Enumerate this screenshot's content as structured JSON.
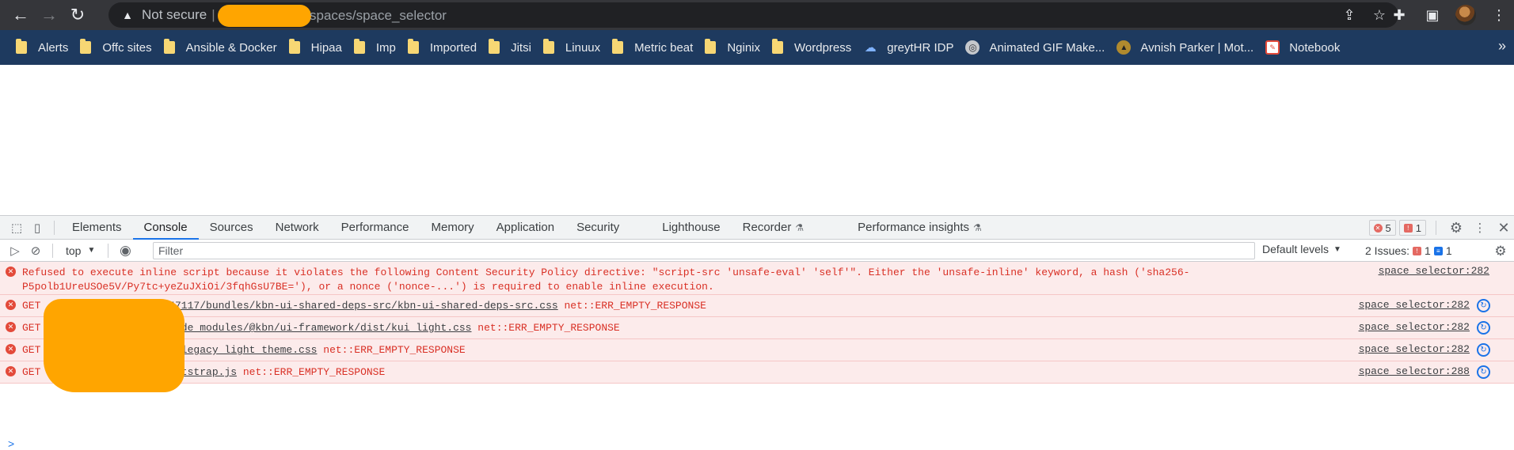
{
  "browser": {
    "not_secure": "Not secure",
    "url_path": "spaces/space_selector",
    "bookmarks": [
      {
        "label": "Alerts",
        "type": "folder"
      },
      {
        "label": "Offc sites",
        "type": "folder"
      },
      {
        "label": "Ansible & Docker",
        "type": "folder"
      },
      {
        "label": "Hipaa",
        "type": "folder"
      },
      {
        "label": "Imp",
        "type": "folder"
      },
      {
        "label": "Imported",
        "type": "folder"
      },
      {
        "label": "Jitsi",
        "type": "folder"
      },
      {
        "label": "Linuux",
        "type": "folder"
      },
      {
        "label": "Metric beat",
        "type": "folder"
      },
      {
        "label": "Nginix",
        "type": "folder"
      },
      {
        "label": "Wordpress",
        "type": "folder"
      },
      {
        "label": "greytHR IDP",
        "type": "site"
      },
      {
        "label": "Animated GIF Make...",
        "type": "site"
      },
      {
        "label": "Avnish Parker | Mot...",
        "type": "site"
      },
      {
        "label": "Notebook",
        "type": "site"
      }
    ]
  },
  "devtools": {
    "tabs": [
      "Elements",
      "Console",
      "Sources",
      "Network",
      "Performance",
      "Memory",
      "Application",
      "Security",
      "Lighthouse",
      "Recorder",
      "Performance insights"
    ],
    "active_tab": "Console",
    "error_count": "5",
    "issue_count_badge": "1",
    "context": "top",
    "filter_placeholder": "Filter",
    "levels": "Default levels",
    "issues_label": "2 Issues:",
    "issues_errors": "1",
    "issues_info": "1",
    "messages": [
      {
        "line1": "Refused to execute inline script because it violates the following Content Security Policy directive: \"script-src 'unsafe-eval' 'self'\". Either the 'unsafe-inline' keyword, a hash ('sha256-",
        "line2": "P5polb1UreUSOe5V/Py7tc+yeZuJXiOi/3fqhGsU7BE='), or a nonce ('nonce-...') is required to enable inline execution.",
        "source": "space_selector:282"
      },
      {
        "method": "GET",
        "url": "/47117/bundles/kbn-ui-shared-deps-src/kbn-ui-shared-deps-src.css",
        "status": "net::ERR_EMPTY_RESPONSE",
        "source": "space_selector:282"
      },
      {
        "method": "GET",
        "url": "/node_modules/@kbn/ui-framework/dist/kui_light.css",
        "status": "net::ERR_EMPTY_RESPONSE",
        "source": "space_selector:282"
      },
      {
        "method": "GET",
        "url": "ui/legacy_light_theme.css",
        "status": "net::ERR_EMPTY_RESPONSE",
        "source": "space_selector:282"
      },
      {
        "method": "GET",
        "url": "bootstrap.js",
        "status": "net::ERR_EMPTY_RESPONSE",
        "source": "space_selector:288"
      }
    ],
    "prompt": ">"
  },
  "colors": {
    "bookmark_bar": "#1e3a5f",
    "toolbar": "#35363a",
    "error_bg": "#fcebeb",
    "error_text": "#d93025",
    "accent": "#1a73e8",
    "redaction": "#ffa500"
  }
}
